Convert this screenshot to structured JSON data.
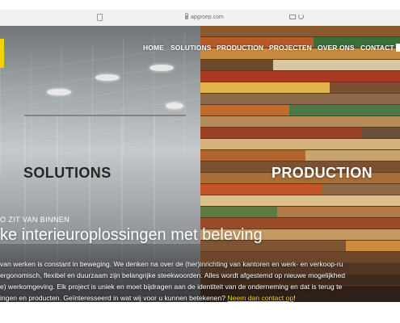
{
  "browser": {
    "url": "apgroep.com"
  },
  "nav": {
    "items": [
      {
        "label": "HOME"
      },
      {
        "label": "SOLUTIONS"
      },
      {
        "label": "PRODUCTION"
      },
      {
        "label": "PROJECTEN"
      },
      {
        "label": "OVER ONS"
      },
      {
        "label": "CONTACT"
      }
    ]
  },
  "hero": {
    "left_title": "SOLUTIONS",
    "right_title": "PRODUCTION",
    "eyebrow": "O ZIT VAN BINNEN",
    "tagline": "ke interieuroplossingen met beleving",
    "body": {
      "line1": " van werken is constant in beweging. We denken na over de (her)inrichting van kantoren en werk- en verkoop-ru",
      "line2": "ergonomisch, flexibel en duurzaam zijn belangrijke steekwoorden. Alles wordt afgestemd op nieuwe mogelijkhed",
      "line3": "e) werkomgeving. Elk project is uniek en moet bijdragen aan de identiteit van de onderneming en dat is terug te",
      "line4_prefix": "ingen en producten. Geïnteresseerd in wat wij voor u kunnen betekenen? ",
      "cta_label": "Neem dan contact op",
      "line4_suffix": "!"
    }
  },
  "colors": {
    "accent": "#f0d200",
    "cta": "#f5d000",
    "nav_text": "#ffffff"
  },
  "icons": [
    "tab-icon",
    "lock-icon",
    "extension-icon",
    "reload-icon"
  ]
}
